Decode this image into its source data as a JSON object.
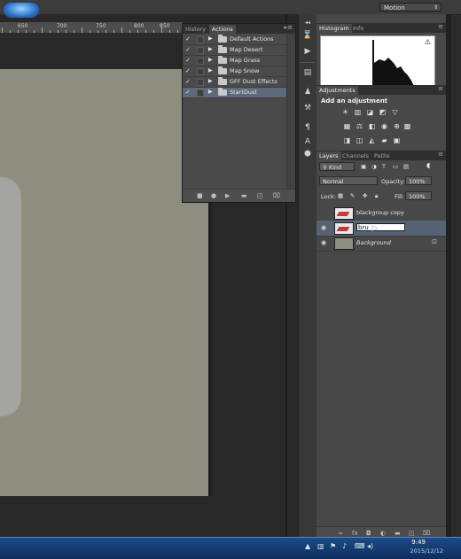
{
  "options_bar": {
    "workspace": "Motion"
  },
  "ruler": {
    "marks": [
      "650",
      "700",
      "750",
      "800",
      "850"
    ]
  },
  "actions_panel": {
    "tabs": [
      "History",
      "Actions"
    ],
    "active_tab": "Actions",
    "sets": [
      {
        "checked": true,
        "label": "Default Actions"
      },
      {
        "checked": true,
        "label": "Map Desert"
      },
      {
        "checked": true,
        "label": "Map Grass"
      },
      {
        "checked": true,
        "label": "Map Snow"
      },
      {
        "checked": true,
        "label": "GFF Dust Effects"
      },
      {
        "checked": true,
        "label": "StartDust",
        "selected": true
      }
    ]
  },
  "histogram_panel": {
    "tabs": [
      "Histogram",
      "Info"
    ],
    "active_tab": "Histogram"
  },
  "adjustments_panel": {
    "tab": "Adjustments",
    "heading": "Add an adjustment"
  },
  "layers_panel": {
    "tabs": [
      "Layers",
      "Channels",
      "Paths"
    ],
    "active_tab": "Layers",
    "filter": "Kind",
    "blend_mode": "Normal",
    "opacity_label": "Opacity:",
    "opacity": "100%",
    "lock_label": "Lock:",
    "fill_label": "Fill:",
    "fill": "100%",
    "layers": [
      {
        "name": "blackgroup copy",
        "visible": false
      },
      {
        "name": "bru",
        "visible": true,
        "selected": true,
        "renaming": true
      },
      {
        "name": "Background",
        "visible": true,
        "locked": true
      }
    ]
  },
  "taskbar": {
    "time": "9:49",
    "date": "2015/12/12"
  },
  "colors": {
    "document": "#8d8e7d",
    "selection": "#566375",
    "panel": "#484848"
  }
}
